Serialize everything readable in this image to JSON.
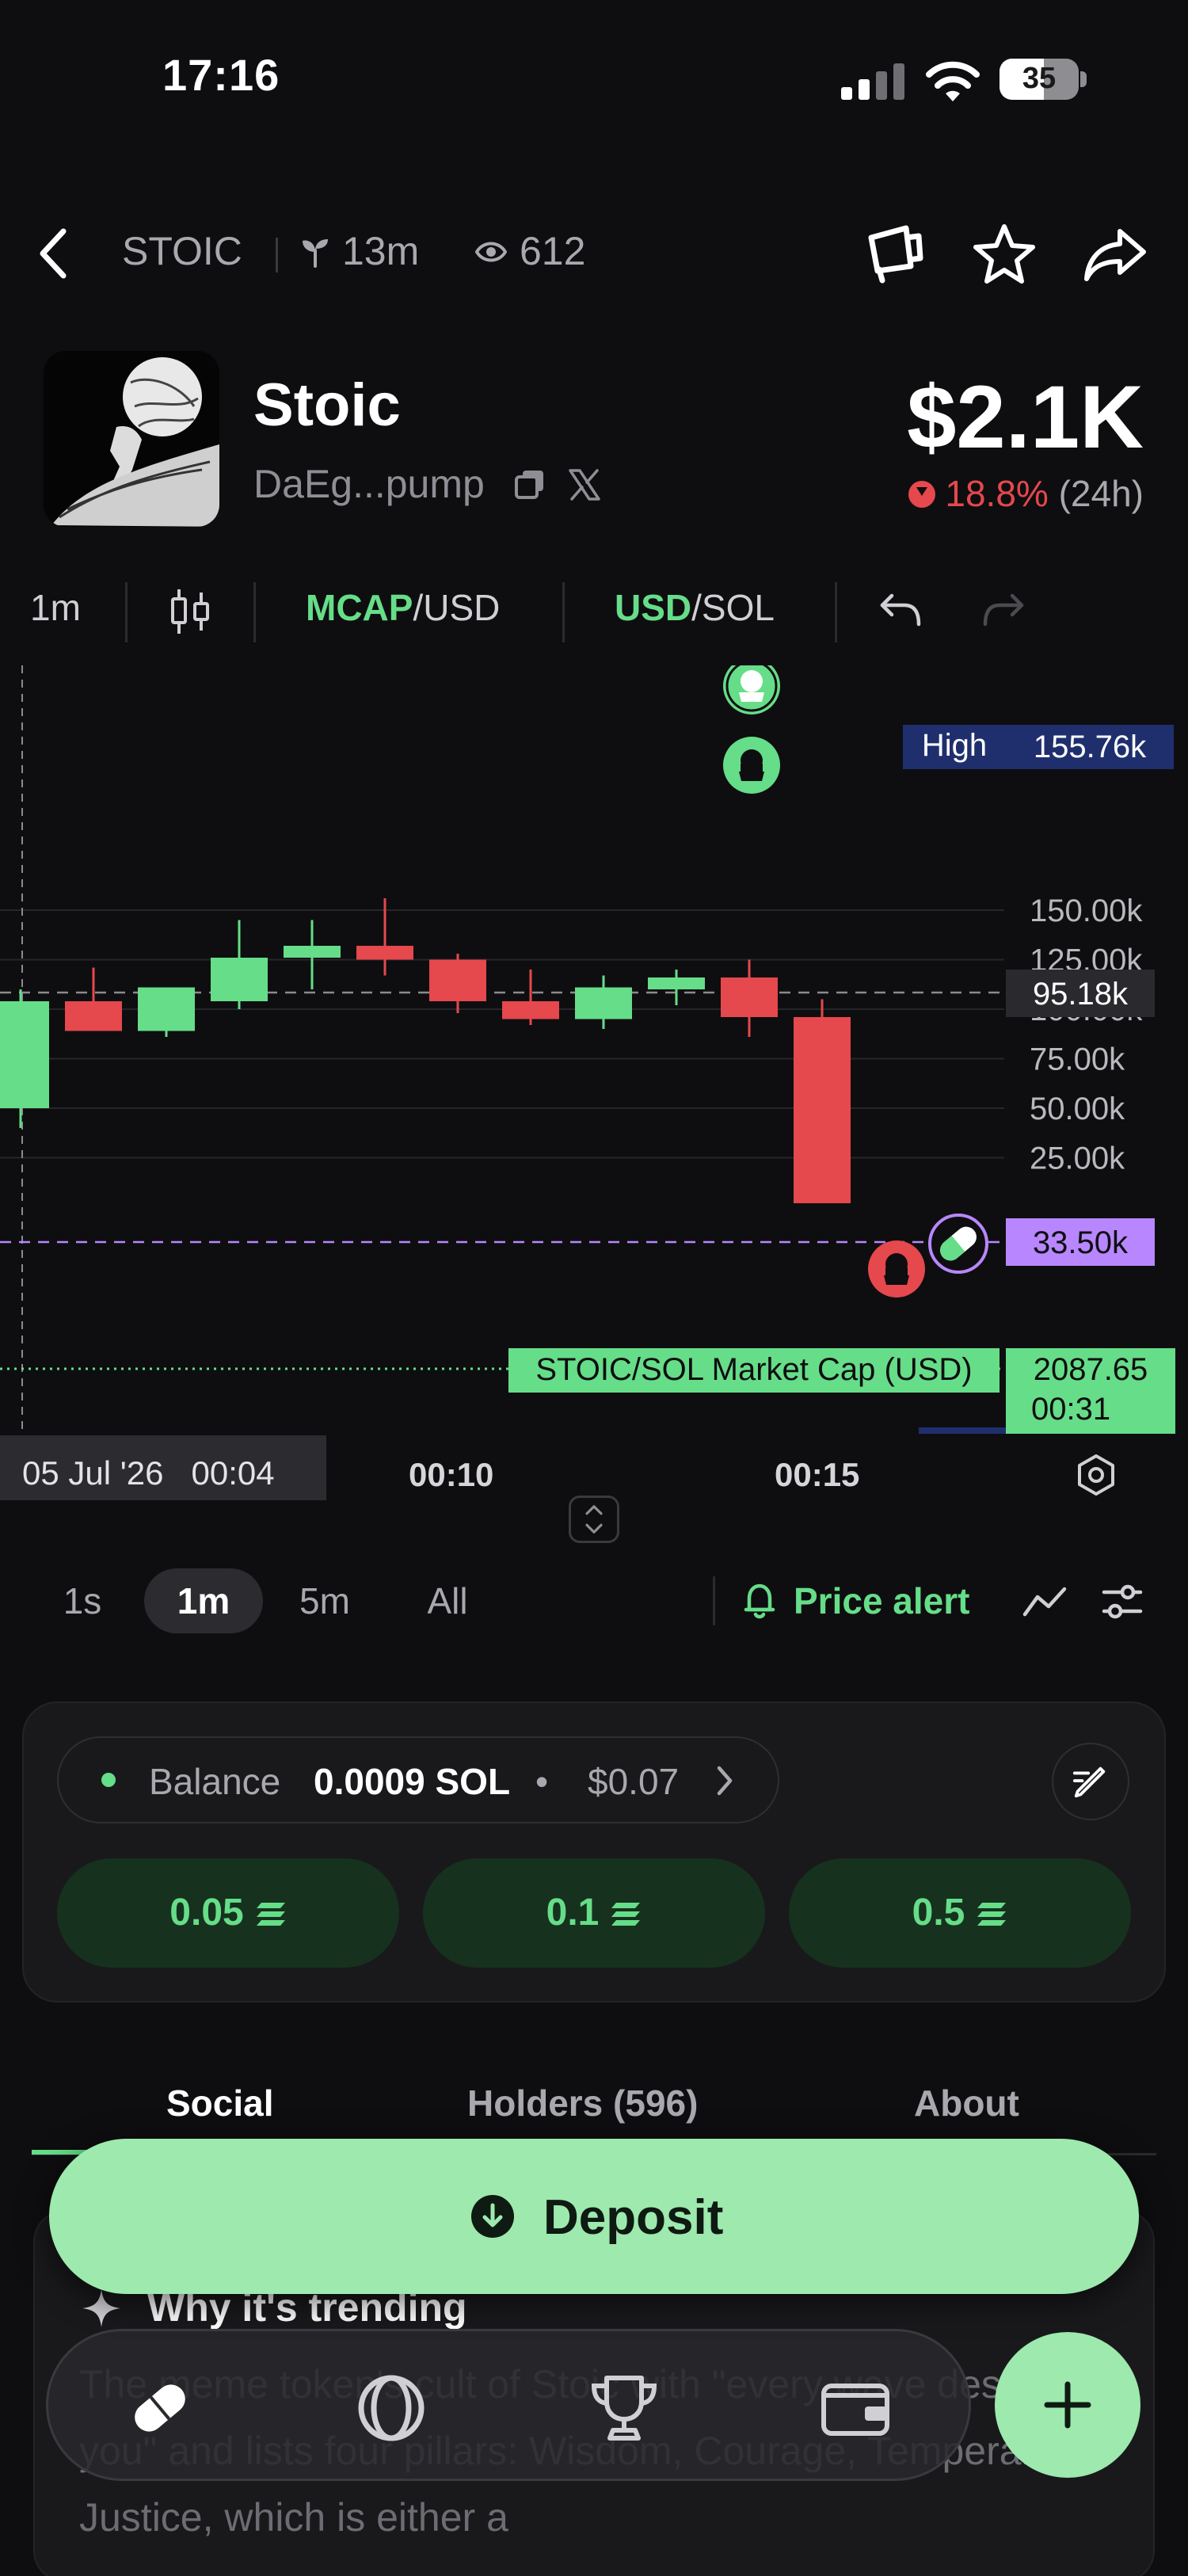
{
  "status_bar": {
    "time": "17:16",
    "battery": "35"
  },
  "header": {
    "ticker": "STOIC",
    "age": "13m",
    "views": "612"
  },
  "token": {
    "name": "Stoic",
    "address": "DaEg...pump",
    "price": "$2.1K",
    "change": "18.8%",
    "period": "(24h)"
  },
  "chart_toolbar": {
    "interval": "1m",
    "mcap_label": "MCAP",
    "mcap_suffix": "/USD",
    "usd_label": "USD",
    "usd_suffix": "/SOL"
  },
  "chart_data": {
    "type": "candlestick",
    "y_ticks": [
      "150.00k",
      "125.00k",
      "100.00k",
      "75.00k",
      "50.00k",
      "25.00k"
    ],
    "candles": [
      {
        "open": 50,
        "high": 110,
        "low": 40,
        "close": 104,
        "color": "green"
      },
      {
        "open": 104,
        "high": 121,
        "low": 90,
        "close": 89,
        "color": "red"
      },
      {
        "open": 89,
        "high": 108,
        "low": 86,
        "close": 111,
        "color": "green"
      },
      {
        "open": 104,
        "high": 145,
        "low": 100,
        "close": 126,
        "color": "green"
      },
      {
        "open": 126,
        "high": 145,
        "low": 110,
        "close": 132,
        "color": "green"
      },
      {
        "open": 132,
        "high": 156,
        "low": 117,
        "close": 125,
        "color": "red"
      },
      {
        "open": 125,
        "high": 128,
        "low": 98,
        "close": 104,
        "color": "red"
      },
      {
        "open": 104,
        "high": 120,
        "low": 92,
        "close": 95,
        "color": "red"
      },
      {
        "open": 95,
        "high": 117,
        "low": 90,
        "close": 111,
        "color": "green"
      },
      {
        "open": 110,
        "high": 120,
        "low": 102,
        "close": 116,
        "color": "green"
      },
      {
        "open": 116,
        "high": 125,
        "low": 86,
        "close": 96,
        "color": "red"
      },
      {
        "open": 96,
        "high": 105,
        "low": 2,
        "close": 2,
        "color": "red"
      }
    ],
    "high_label": "High",
    "high_value": "155.76k",
    "current_value": "95.18k",
    "entry_value": "33.50k",
    "market_cap_label": "STOIC/SOL Market Cap (USD)",
    "market_cap_value": "2087.65",
    "countdown": "00:31",
    "x_labels": [
      "00:10",
      "00:15"
    ],
    "crosshair_date": "05 Jul '26",
    "crosshair_time": "00:04"
  },
  "timeframes": [
    "1s",
    "1m",
    "5m",
    "All"
  ],
  "price_alert": "Price alert",
  "trade": {
    "balance_label": "Balance",
    "balance_sol": "0.0009 SOL",
    "balance_usd": "$0.07",
    "amounts": [
      "0.05",
      "0.1",
      "0.5"
    ]
  },
  "tabs": [
    "Social",
    "Holders (596)",
    "About"
  ],
  "social": {
    "title": "Why it's trending",
    "body": "The meme token's cult of Stoic with  \"every wave destroys you\" and lists four pillars: Wisdom, Courage, Temperance, Justice, which is either a"
  },
  "deposit_label": "Deposit",
  "colors": {
    "accent": "#66dd88",
    "down": "#e5484d",
    "deposit": "#9de9ae",
    "background": "#0e0e10"
  }
}
